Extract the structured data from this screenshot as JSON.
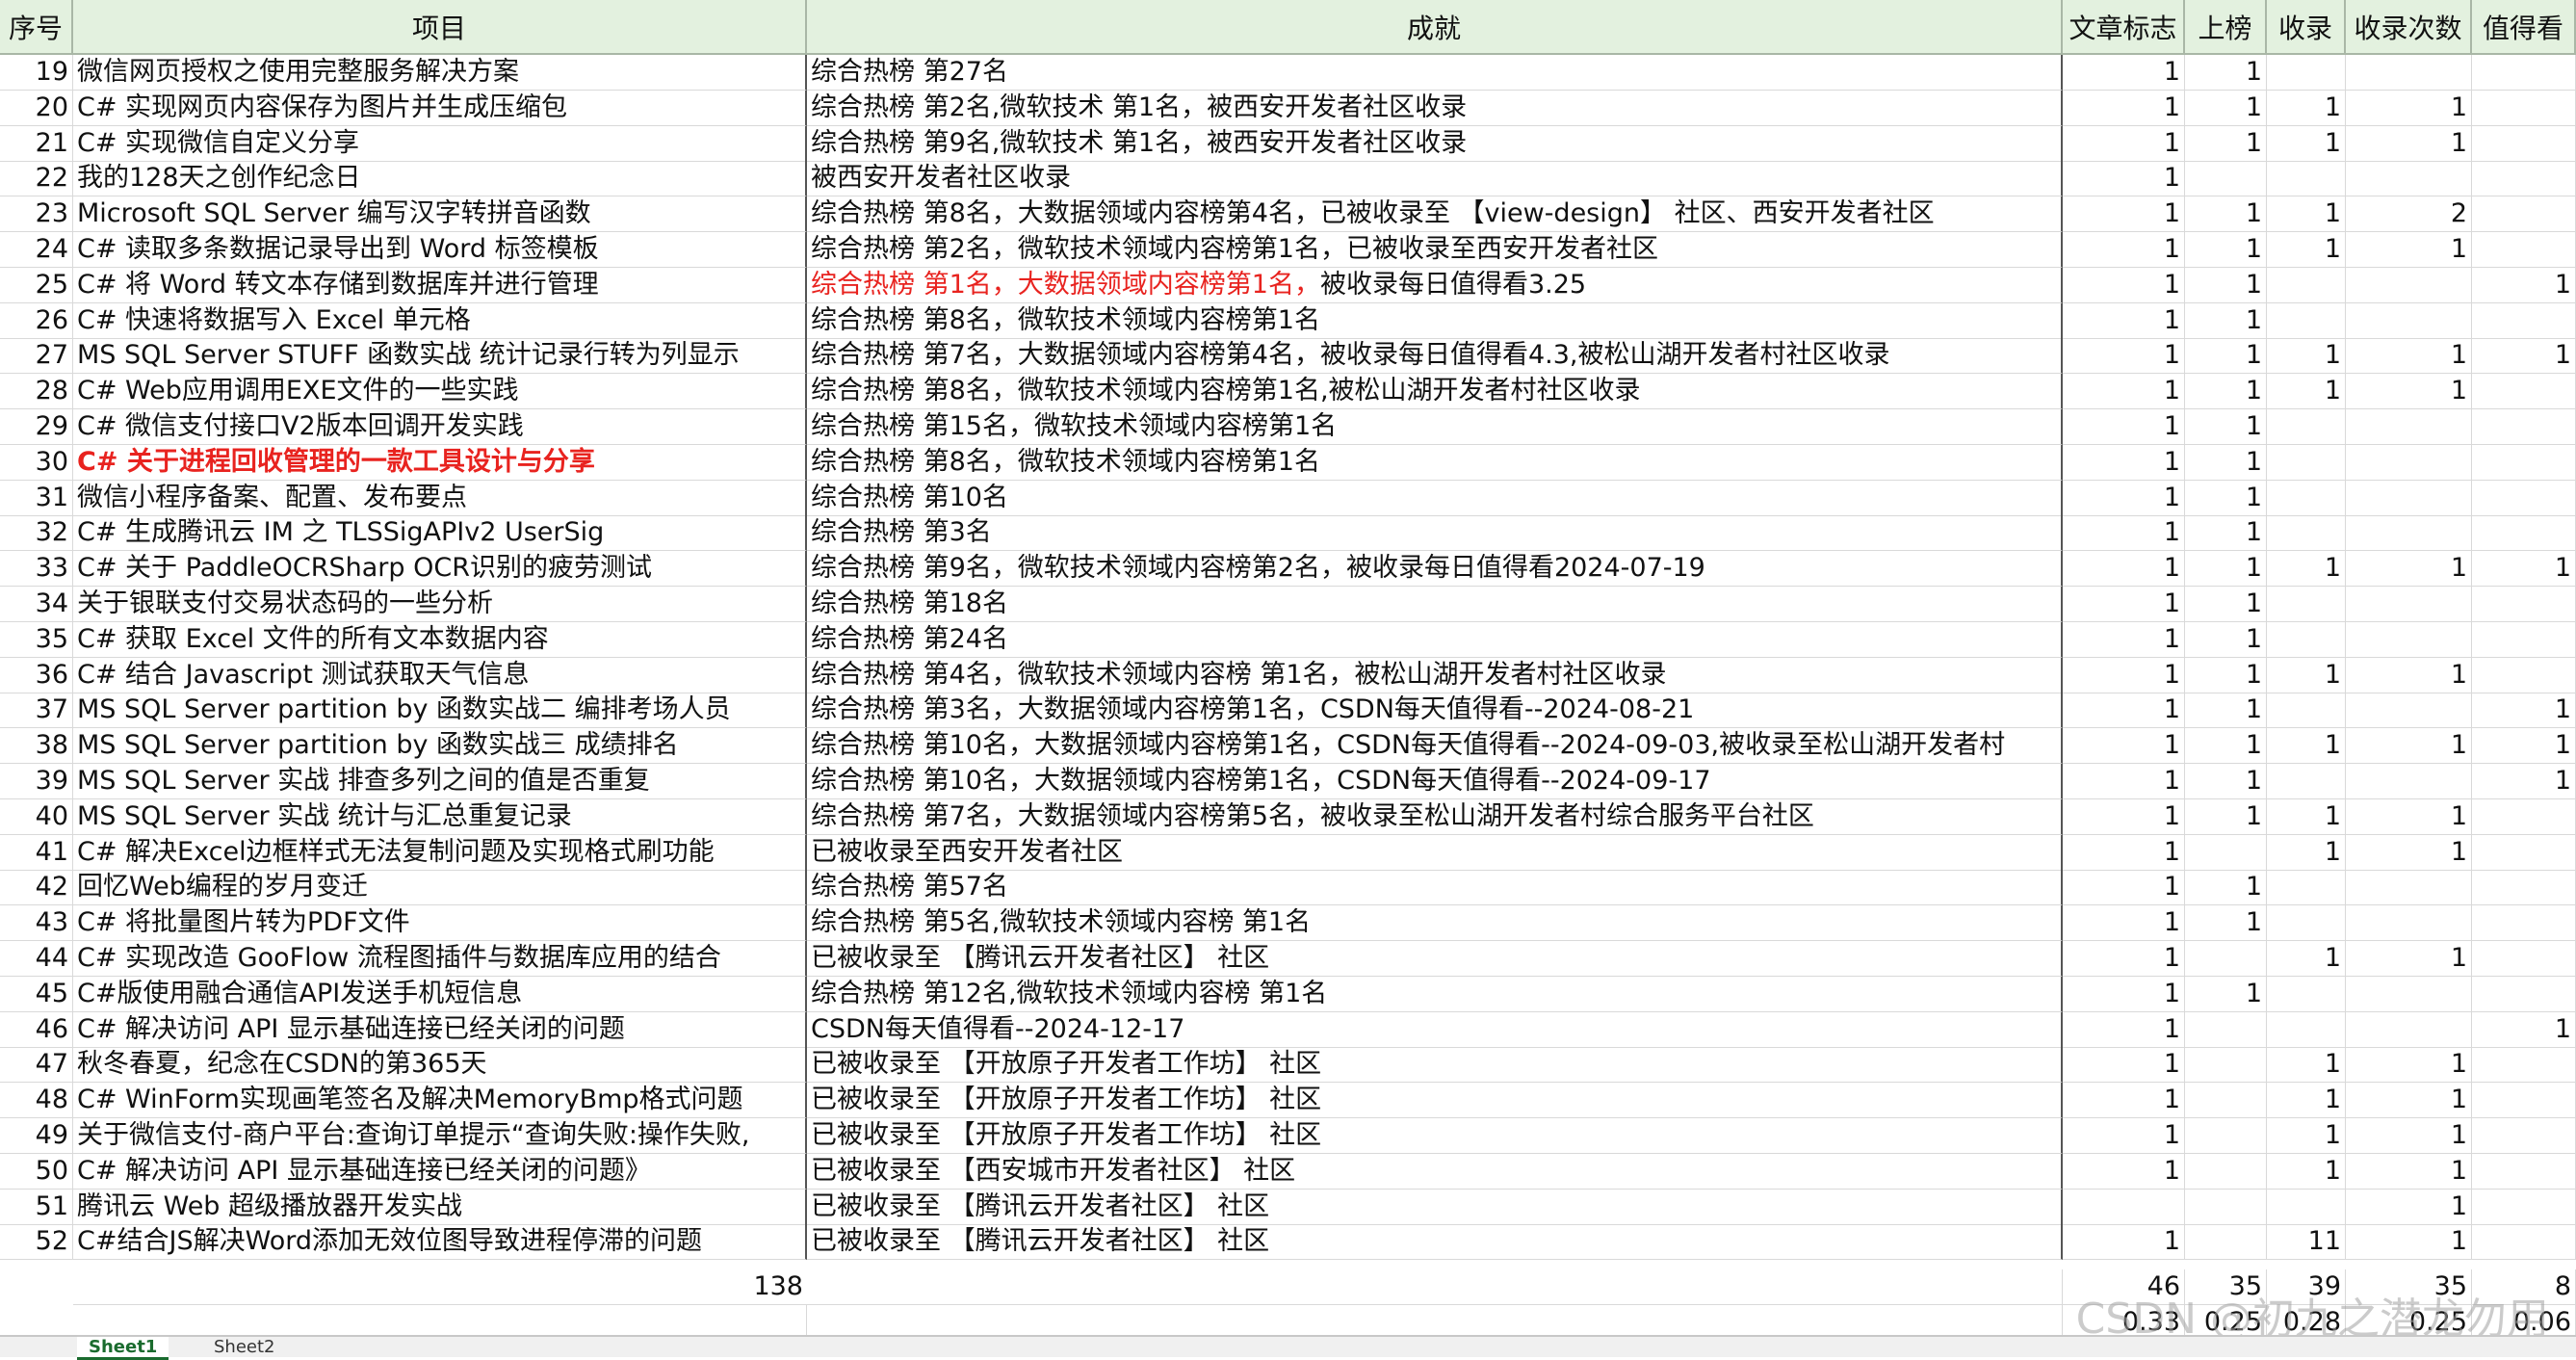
{
  "headers": [
    "序号",
    "项目",
    "成就",
    "文章标志",
    "上榜",
    "收录",
    "收录次数",
    "值得看"
  ],
  "rows": [
    {
      "n": "19",
      "title": "微信网页授权之使用完整服务解决方案",
      "ach": "综合热榜 第27名",
      "flag": "1",
      "rank": "1",
      "inc": "",
      "cnt": "",
      "worth": ""
    },
    {
      "n": "20",
      "title": "C# 实现网页内容保存为图片并生成压缩包",
      "ach": "综合热榜 第2名,微软技术 第1名，被西安开发者社区收录",
      "flag": "1",
      "rank": "1",
      "inc": "1",
      "cnt": "1",
      "worth": ""
    },
    {
      "n": "21",
      "title": "C# 实现微信自定义分享",
      "ach": "综合热榜 第9名,微软技术 第1名，被西安开发者社区收录",
      "flag": "1",
      "rank": "1",
      "inc": "1",
      "cnt": "1",
      "worth": ""
    },
    {
      "n": "22",
      "title": "我的128天之创作纪念日",
      "ach": "被西安开发者社区收录",
      "flag": "1",
      "rank": "",
      "inc": "",
      "cnt": "",
      "worth": ""
    },
    {
      "n": "23",
      "title": "Microsoft SQL Server 编写汉字转拼音函数",
      "ach": "综合热榜 第8名，大数据领域内容榜第4名，已被收录至 【view-design】 社区、西安开发者社区",
      "flag": "1",
      "rank": "1",
      "inc": "1",
      "cnt": "2",
      "worth": ""
    },
    {
      "n": "24",
      "title": "C# 读取多条数据记录导出到 Word 标签模板",
      "ach": "综合热榜 第2名，微软技术领域内容榜第1名，已被收录至西安开发者社区",
      "flag": "1",
      "rank": "1",
      "inc": "1",
      "cnt": "1",
      "worth": ""
    },
    {
      "n": "25",
      "title": "C# 将 Word 转文本存储到数据库并进行管理",
      "ach": "综合热榜 第1名，大数据领域内容榜第1名，",
      "ach2": "被收录每日值得看3.25",
      "red": true,
      "flag": "1",
      "rank": "1",
      "inc": "",
      "cnt": "",
      "worth": "1"
    },
    {
      "n": "26",
      "title": "C# 快速将数据写入 Excel 单元格",
      "ach": "综合热榜 第8名，微软技术领域内容榜第1名",
      "flag": "1",
      "rank": "1",
      "inc": "",
      "cnt": "",
      "worth": ""
    },
    {
      "n": "27",
      "title": "MS SQL Server STUFF 函数实战 统计记录行转为列显示",
      "ach": "综合热榜 第7名，大数据领域内容榜第4名，被收录每日值得看4.3,被松山湖开发者村社区收录",
      "flag": "1",
      "rank": "1",
      "inc": "1",
      "cnt": "1",
      "worth": "1"
    },
    {
      "n": "28",
      "title": "C# Web应用调用EXE文件的一些实践",
      "ach": "综合热榜 第8名，微软技术领域内容榜第1名,被松山湖开发者村社区收录",
      "flag": "1",
      "rank": "1",
      "inc": "1",
      "cnt": "1",
      "worth": ""
    },
    {
      "n": "29",
      "title": "C# 微信支付接口V2版本回调开发实践",
      "ach": "综合热榜 第15名，微软技术领域内容榜第1名",
      "flag": "1",
      "rank": "1",
      "inc": "",
      "cnt": "",
      "worth": ""
    },
    {
      "n": "30",
      "title": "C# 关于进程回收管理的一款工具设计与分享",
      "titleRed": true,
      "ach": "综合热榜 第8名，微软技术领域内容榜第1名",
      "flag": "1",
      "rank": "1",
      "inc": "",
      "cnt": "",
      "worth": ""
    },
    {
      "n": "31",
      "title": "微信小程序备案、配置、发布要点",
      "ach": "综合热榜 第10名",
      "flag": "1",
      "rank": "1",
      "inc": "",
      "cnt": "",
      "worth": ""
    },
    {
      "n": "32",
      "title": "C# 生成腾讯云 IM 之 TLSSigAPIv2 UserSig",
      "ach": "综合热榜 第3名",
      "flag": "1",
      "rank": "1",
      "inc": "",
      "cnt": "",
      "worth": ""
    },
    {
      "n": "33",
      "title": "C# 关于 PaddleOCRSharp OCR识别的疲劳测试",
      "ach": "综合热榜 第9名，微软技术领域内容榜第2名，被收录每日值得看2024-07-19",
      "flag": "1",
      "rank": "1",
      "inc": "1",
      "cnt": "1",
      "worth": "1"
    },
    {
      "n": "34",
      "title": "关于银联支付交易状态码的一些分析",
      "ach": "综合热榜 第18名",
      "flag": "1",
      "rank": "1",
      "inc": "",
      "cnt": "",
      "worth": ""
    },
    {
      "n": "35",
      "title": "C# 获取 Excel 文件的所有文本数据内容",
      "ach": "综合热榜 第24名",
      "flag": "1",
      "rank": "1",
      "inc": "",
      "cnt": "",
      "worth": ""
    },
    {
      "n": "36",
      "title": "C# 结合 Javascript 测试获取天气信息",
      "ach": "综合热榜 第4名，微软技术领域内容榜 第1名，被松山湖开发者村社区收录",
      "flag": "1",
      "rank": "1",
      "inc": "1",
      "cnt": "1",
      "worth": ""
    },
    {
      "n": "37",
      "title": "MS SQL Server partition by 函数实战二 编排考场人员",
      "ach": "综合热榜 第3名，大数据领域内容榜第1名，CSDN每天值得看--2024-08-21",
      "flag": "1",
      "rank": "1",
      "inc": "",
      "cnt": "",
      "worth": "1"
    },
    {
      "n": "38",
      "title": "MS SQL Server partition by 函数实战三 成绩排名",
      "ach": "综合热榜 第10名，大数据领域内容榜第1名，CSDN每天值得看--2024-09-03,被收录至松山湖开发者村",
      "flag": "1",
      "rank": "1",
      "inc": "1",
      "cnt": "1",
      "worth": "1"
    },
    {
      "n": "39",
      "title": "MS SQL Server 实战 排查多列之间的值是否重复",
      "ach": "综合热榜 第10名，大数据领域内容榜第1名，CSDN每天值得看--2024-09-17",
      "flag": "1",
      "rank": "1",
      "inc": "",
      "cnt": "",
      "worth": "1"
    },
    {
      "n": "40",
      "title": "MS SQL Server 实战 统计与汇总重复记录",
      "ach": "综合热榜 第7名，大数据领域内容榜第5名，被收录至松山湖开发者村综合服务平台社区",
      "flag": "1",
      "rank": "1",
      "inc": "1",
      "cnt": "1",
      "worth": ""
    },
    {
      "n": "41",
      "title": "C# 解决Excel边框样式无法复制问题及实现格式刷功能",
      "ach": "已被收录至西安开发者社区",
      "flag": "1",
      "rank": "",
      "inc": "1",
      "cnt": "1",
      "worth": ""
    },
    {
      "n": "42",
      "title": "回忆Web编程的岁月变迁",
      "ach": "综合热榜 第57名",
      "flag": "1",
      "rank": "1",
      "inc": "",
      "cnt": "",
      "worth": ""
    },
    {
      "n": "43",
      "title": "C# 将批量图片转为PDF文件",
      "ach": "综合热榜 第5名,微软技术领域内容榜 第1名",
      "flag": "1",
      "rank": "1",
      "inc": "",
      "cnt": "",
      "worth": ""
    },
    {
      "n": "44",
      "title": "C# 实现改造 GooFlow 流程图插件与数据库应用的结合",
      "ach": "已被收录至 【腾讯云开发者社区】 社区",
      "flag": "1",
      "rank": "",
      "inc": "1",
      "cnt": "1",
      "worth": ""
    },
    {
      "n": "45",
      "title": "C#版使用融合通信API发送手机短信息",
      "ach": "综合热榜 第12名,微软技术领域内容榜 第1名",
      "flag": "1",
      "rank": "1",
      "inc": "",
      "cnt": "",
      "worth": ""
    },
    {
      "n": "46",
      "title": " C# 解决访问 API 显示基础连接已经关闭的问题",
      "ach": "CSDN每天值得看--2024-12-17",
      "flag": "1",
      "rank": "",
      "inc": "",
      "cnt": "",
      "worth": "1"
    },
    {
      "n": "47",
      "title": "秋冬春夏，纪念在CSDN的第365天",
      "ach": "已被收录至 【开放原子开发者工作坊】 社区",
      "flag": "1",
      "rank": "",
      "inc": "1",
      "cnt": "1",
      "worth": ""
    },
    {
      "n": "48",
      "title": "C# WinForm实现画笔签名及解决MemoryBmp格式问题",
      "ach": "已被收录至 【开放原子开发者工作坊】 社区",
      "flag": "1",
      "rank": "",
      "inc": "1",
      "cnt": "1",
      "worth": ""
    },
    {
      "n": "49",
      "title": " 关于微信支付-商户平台:查询订单提示“查询失败:操作失败,",
      "ach": "已被收录至 【开放原子开发者工作坊】 社区",
      "flag": "1",
      "rank": "",
      "inc": "1",
      "cnt": "1",
      "worth": ""
    },
    {
      "n": "50",
      "title": "C# 解决访问 API 显示基础连接已经关闭的问题》",
      "ach": "已被收录至 【西安城市开发者社区】 社区",
      "flag": "1",
      "rank": "",
      "inc": "1",
      "cnt": "1",
      "worth": ""
    },
    {
      "n": "51",
      "title": "腾讯云 Web 超级播放器开发实战",
      "ach": "已被收录至 【腾讯云开发者社区】 社区",
      "flag": "",
      "rank": "",
      "inc": "",
      "cnt": "1",
      "worth": ""
    },
    {
      "n": "52",
      "title": " C#结合JS解决Word添加无效位图导致进程停滞的问题",
      "ach": "已被收录至 【腾讯云开发者社区】 社区",
      "flag": "1",
      "rank": "",
      "inc": "11",
      "cnt": "1",
      "worth": ""
    }
  ],
  "totals": {
    "count": "138",
    "flag": "46",
    "rank": "35",
    "inc": "39",
    "cnt": "35",
    "worth": "8"
  },
  "ratios": {
    "flag": "0.33",
    "rank": "0.25",
    "inc": "0.28",
    "cnt": "0.25",
    "worth": "0.06"
  },
  "tabs": [
    "Sheet1",
    "Sheet2"
  ],
  "watermark": "CSDN @初九之潜龙勿用",
  "colors": {
    "header_bg": "#e3f1df",
    "highlight_red": "#e8231f"
  }
}
